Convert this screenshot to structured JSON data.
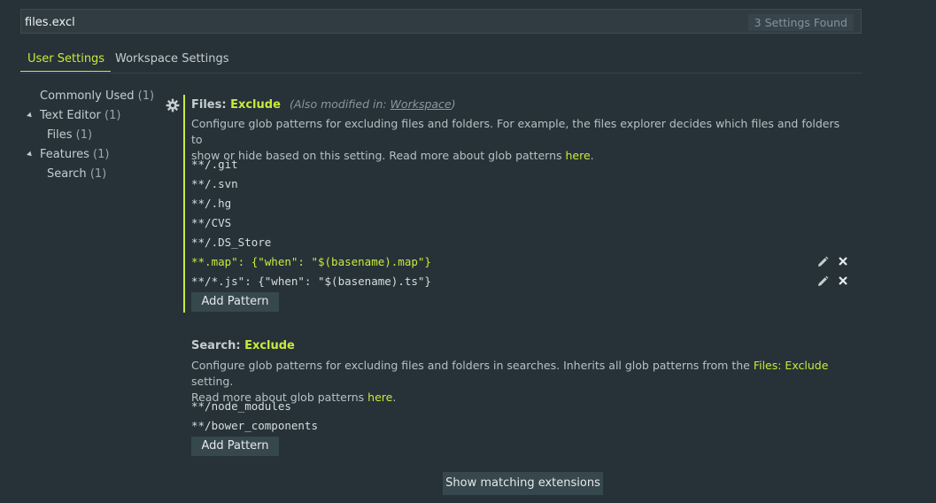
{
  "search": {
    "value": "files.excl",
    "results_label": "3 Settings Found"
  },
  "tabs": [
    {
      "label": "User Settings",
      "active": true
    },
    {
      "label": "Workspace Settings",
      "active": false
    }
  ],
  "tree": [
    {
      "label": "Commonly Used",
      "count": "(1)",
      "expanded": null,
      "level": 0
    },
    {
      "label": "Text Editor",
      "count": "(1)",
      "expanded": true,
      "level": 0
    },
    {
      "label": "Files",
      "count": "(1)",
      "expanded": null,
      "level": 1
    },
    {
      "label": "Features",
      "count": "(1)",
      "expanded": true,
      "level": 0
    },
    {
      "label": "Search",
      "count": "(1)",
      "expanded": null,
      "level": 1
    }
  ],
  "setting_files_exclude": {
    "category": "Files: ",
    "key": "Exclude",
    "modified_prefix": "(Also modified in: ",
    "modified_link": "Workspace",
    "modified_suffix": ")",
    "description_line1": "Configure glob patterns for excluding files and folders. For example, the files explorer decides which files and folders to",
    "description_line2": "show or hide based on this setting. Read more about glob patterns ",
    "description_link": "here",
    "description_end": ".",
    "patterns": [
      "**/.git",
      "**/.svn",
      "**/.hg",
      "**/CVS",
      "**/.DS_Store",
      "**.map\": {\"when\": \"$(basename).map\"}",
      "**/*.js\": {\"when\": \"$(basename).ts\"}"
    ],
    "add_button": "Add Pattern"
  },
  "setting_search_exclude": {
    "category": "Search: ",
    "key": "Exclude",
    "description_line1_a": "Configure glob patterns for excluding files and folders in searches. Inherits all glob patterns from the ",
    "description_line1_link": "Files: Exclude",
    "description_line1_b": " setting.",
    "description_line2": "Read more about glob patterns ",
    "description_link": "here",
    "description_end": ".",
    "patterns": [
      "**/node_modules",
      "**/bower_components"
    ],
    "add_button": "Add Pattern"
  },
  "footer": {
    "show_extensions": "Show matching extensions"
  },
  "colors": {
    "accent": "#cbe93b",
    "background": "#263238"
  },
  "icons": {
    "gear": "gear-icon",
    "edit": "pencil-icon",
    "delete": "close-icon"
  }
}
